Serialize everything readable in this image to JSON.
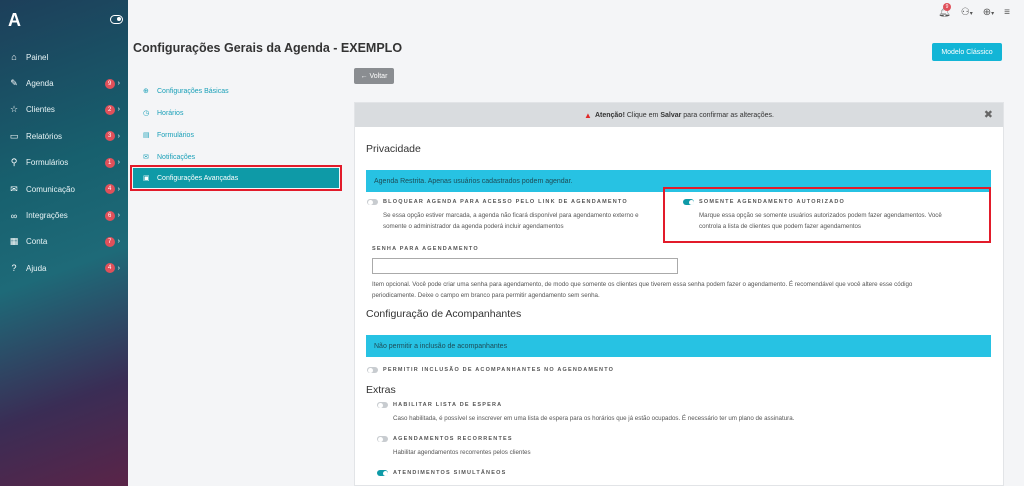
{
  "sidebar": {
    "logo": "A",
    "items": [
      {
        "icon": "home-icon",
        "glyph": "⌂",
        "label": "Painel",
        "badge": "",
        "arrow": ""
      },
      {
        "icon": "calendar-edit-icon",
        "glyph": "✎",
        "label": "Agenda",
        "badge": "9",
        "arrow": "›"
      },
      {
        "icon": "star-icon",
        "glyph": "☆",
        "label": "Clientes",
        "badge": "2",
        "arrow": "›"
      },
      {
        "icon": "report-icon",
        "glyph": "▭",
        "label": "Relatórios",
        "badge": "3",
        "arrow": "›"
      },
      {
        "icon": "search-icon",
        "glyph": "⚲",
        "label": "Formulários",
        "badge": "1",
        "arrow": "›"
      },
      {
        "icon": "mail-icon",
        "glyph": "✉",
        "label": "Comunicação",
        "badge": "4",
        "arrow": "›"
      },
      {
        "icon": "link-icon",
        "glyph": "∞",
        "label": "Integrações",
        "badge": "6",
        "arrow": "›"
      },
      {
        "icon": "building-icon",
        "glyph": "▦",
        "label": "Conta",
        "badge": "7",
        "arrow": "›"
      },
      {
        "icon": "help-icon",
        "glyph": "?",
        "label": "Ajuda",
        "badge": "4",
        "arrow": "›"
      }
    ]
  },
  "topbar": {
    "notifications_badge": "9"
  },
  "header": {
    "title": "Configurações Gerais da Agenda - EXEMPLO",
    "classic_button": "Modelo Clássico",
    "back_button": "← Voltar"
  },
  "settings_menu": {
    "items": [
      {
        "icon": "globe-icon",
        "glyph": "⊕",
        "label": "Configurações Básicas"
      },
      {
        "icon": "clock-icon",
        "glyph": "◷",
        "label": "Horários"
      },
      {
        "icon": "file-icon",
        "glyph": "▤",
        "label": "Formulários"
      },
      {
        "icon": "envelope-icon",
        "glyph": "✉",
        "label": "Notificações"
      },
      {
        "icon": "lock-icon",
        "glyph": "🔒",
        "label": "Configurações Avançadas"
      }
    ]
  },
  "alert": {
    "strong": "Atenção!",
    "text_before": " Clique em ",
    "save_word": "Salvar",
    "text_after": " para confirmar as alterações.",
    "close": "✖"
  },
  "privacy": {
    "title": "Privacidade",
    "info": "Agenda Restrita. Apenas usuários cadastrados podem agendar.",
    "block_link": {
      "label": "BLOQUEAR AGENDA PARA ACESSO PELO LINK DE AGENDAMENTO",
      "desc1": "Se essa opção estiver marcada, a agenda não ficará disponível para agendamento externo e",
      "desc2": "somente o administrador da agenda poderá incluir agendamentos",
      "on": false
    },
    "authorized_only": {
      "label": "SOMENTE AGENDAMENTO AUTORIZADO",
      "desc1": "Marque essa opção se somente usuários autorizados podem fazer agendamentos. Você",
      "desc2": "controla a lista de clientes que podem fazer agendamentos",
      "on": true
    },
    "password": {
      "label": "SENHA PARA AGENDAMENTO",
      "value": "",
      "help1": "Item opcional. Você pode criar uma senha para agendamento, de modo que somente os clientes que tiverem essa senha podem fazer o agendamento. É recomendável que você altere esse código",
      "help2": "periodicamente. Deixe o campo em branco para permitir agendamento sem senha."
    }
  },
  "companions": {
    "title": "Configuração de Acompanhantes",
    "info": "Não permitir a inclusão de acompanhantes",
    "allow": {
      "label": "PERMITIR INCLUSÃO DE ACOMPANHANTES NO AGENDAMENTO",
      "on": false
    }
  },
  "extras": {
    "title": "Extras",
    "waitlist": {
      "label": "HABILITAR LISTA DE ESPERA",
      "desc": "Caso habilitada, é possível se inscrever em uma lista de espera para os horários que já estão ocupados. É necessário ter um plano de assinatura.",
      "on": false
    },
    "recurring": {
      "label": "AGENDAMENTOS RECORRENTES",
      "desc": "Habilitar agendamentos recorrentes pelos clientes",
      "on": false
    },
    "simultaneous": {
      "label": "ATENDIMENTOS SIMULTÂNEOS",
      "on": true
    }
  },
  "colors": {
    "accent": "#0e9aa7",
    "info": "#27c2e3",
    "highlight": "#e21b2a",
    "badge": "#e0505a"
  }
}
